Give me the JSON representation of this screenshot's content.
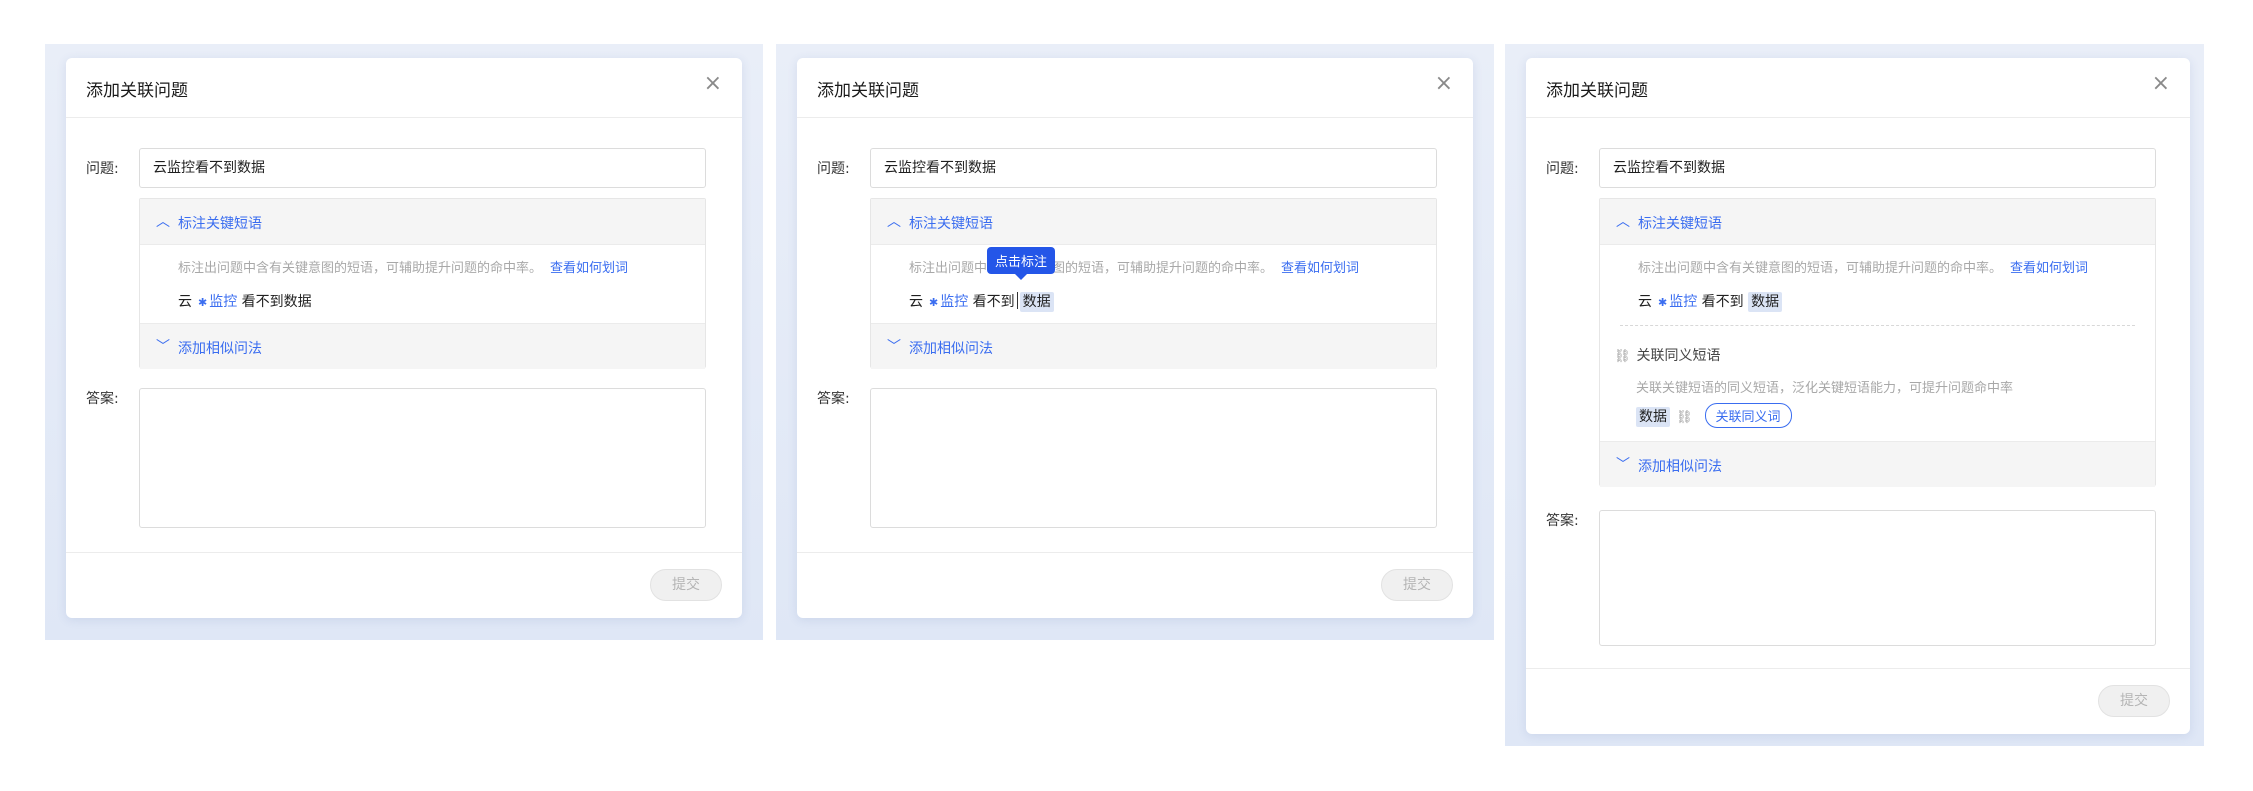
{
  "dialog_title": "添加关联问题",
  "close_glyph": "×",
  "question_label": "问题:",
  "question_value": "云监控看不到数据",
  "answer_label": "答案:",
  "submit_label": "提交",
  "keyword_section": {
    "title": "标注关键短语",
    "hint": "标注出问题中含有关键意图的短语，可辅助提升问题的命中率。",
    "hint_link": "查看如何划词",
    "tokens": [
      "云",
      "监控",
      "看不到",
      "数据"
    ]
  },
  "similar_section": {
    "title": "添加相似问法"
  },
  "tooltip": {
    "text": "点击标注"
  },
  "synonym_section": {
    "title": "关联同义短语",
    "hint": "关联关键短语的同义短语，泛化关键短语能力，可提升问题命中率",
    "word": "数据",
    "button": "关联同义词"
  },
  "icons": {
    "chevron_up": "chevron-up-icon",
    "chevron_down": "chevron-down-icon",
    "star": "star-icon",
    "link": "link-icon",
    "close": "close-icon"
  },
  "colors": {
    "accent": "#3a6df0",
    "tooltip_bg": "#2456e8",
    "highlight_bg": "#dbe4f5"
  }
}
